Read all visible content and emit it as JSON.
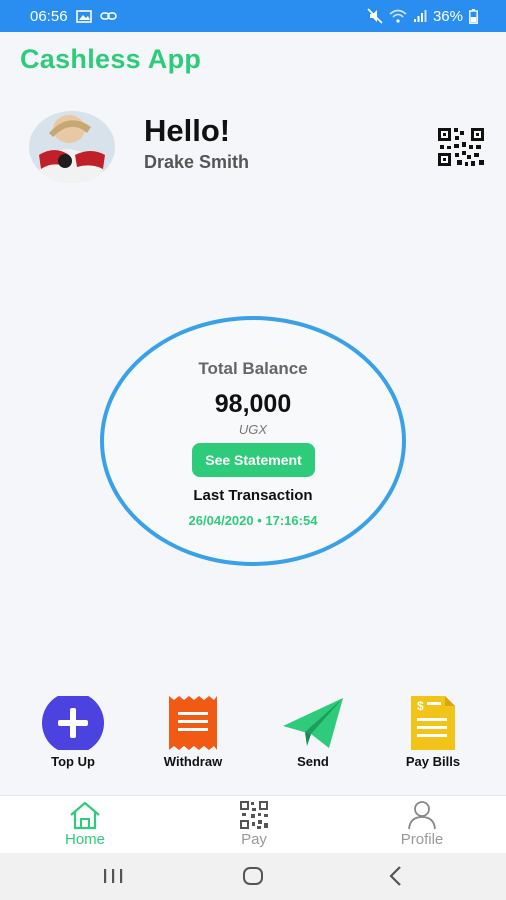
{
  "status": {
    "time": "06:56",
    "battery": "36%"
  },
  "app": {
    "title": "Cashless App"
  },
  "user": {
    "greeting": "Hello!",
    "name": "Drake Smith"
  },
  "balance": {
    "label": "Total Balance",
    "amount": "98,000",
    "currency": "UGX",
    "statement_button": "See Statement",
    "last_label": "Last Transaction",
    "last_value": "26/04/2020 • 17:16:54"
  },
  "actions": [
    {
      "label": "Top Up",
      "icon": "plus-circle-icon",
      "color": "#4b42e0"
    },
    {
      "label": "Withdraw",
      "icon": "receipt-icon",
      "color": "#f05a14"
    },
    {
      "label": "Send",
      "icon": "paper-plane-icon",
      "color": "#2ecc7a"
    },
    {
      "label": "Pay Bills",
      "icon": "bill-document-icon",
      "color": "#f2c318"
    }
  ],
  "nav": [
    {
      "label": "Home",
      "icon": "home-icon",
      "active": true
    },
    {
      "label": "Pay",
      "icon": "qr-code-icon",
      "active": false
    },
    {
      "label": "Profile",
      "icon": "person-icon",
      "active": false
    }
  ],
  "colors": {
    "status_bar": "#2a8ef0",
    "accent": "#2ecc7a",
    "circle": "#3aa0e8"
  }
}
